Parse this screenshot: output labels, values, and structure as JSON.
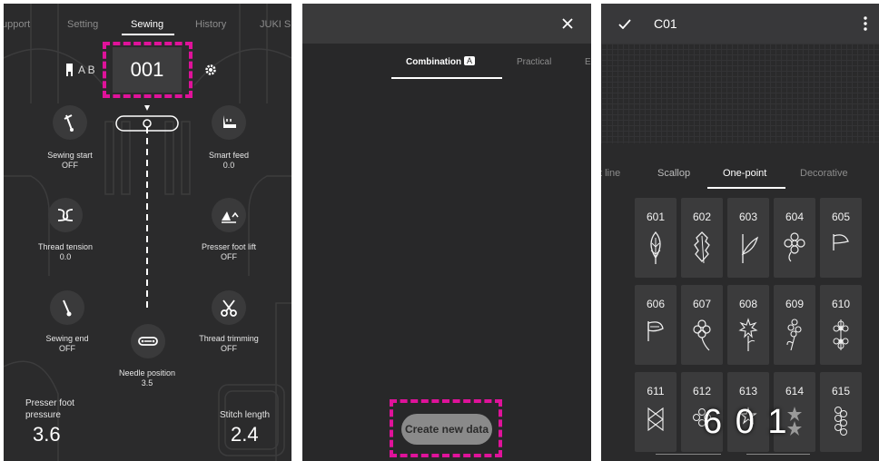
{
  "panel1": {
    "tabs": [
      "upport",
      "Setting",
      "Sewing",
      "History",
      "JUKI S"
    ],
    "active_tab": "Sewing",
    "ab_label": "A B",
    "pattern_number": "001",
    "items": {
      "sewing_start": {
        "label": "Sewing start",
        "value": "OFF"
      },
      "smart_feed": {
        "label": "Smart feed",
        "value": "0.0"
      },
      "thread_tension": {
        "label": "Thread tension",
        "value": "0.0"
      },
      "presser_foot_lift": {
        "label": "Presser foot lift",
        "value": "OFF"
      },
      "sewing_end": {
        "label": "Sewing end",
        "value": "OFF"
      },
      "thread_trimming": {
        "label": "Thread trimming",
        "value": "OFF"
      },
      "needle_position": {
        "label": "Needle position",
        "value": "3.5"
      }
    },
    "presser_pressure": {
      "label_line1": "Presser foot",
      "label_line2": "pressure",
      "value": "3.6"
    },
    "stitch_length": {
      "label": "Stitch length",
      "value": "2.4"
    }
  },
  "panel2": {
    "tab_active": "Combination",
    "tab_badge": "A",
    "tab_second": "Practical",
    "tab_third": "E",
    "create_button": "Create new data"
  },
  "panel3": {
    "title": "C01",
    "tabs": [
      "t line",
      "Scallop",
      "One-point",
      "Decorative"
    ],
    "active_tab": "One-point",
    "tiles": [
      "601",
      "602",
      "603",
      "604",
      "605",
      "606",
      "607",
      "608",
      "609",
      "610",
      "611",
      "612",
      "613",
      "614",
      "615"
    ],
    "overlay_number": "6 0 1"
  },
  "colors": {
    "highlight": "#e0129a",
    "panel_bg": "#2b2b2c",
    "tile_bg": "#3b3b3c"
  }
}
